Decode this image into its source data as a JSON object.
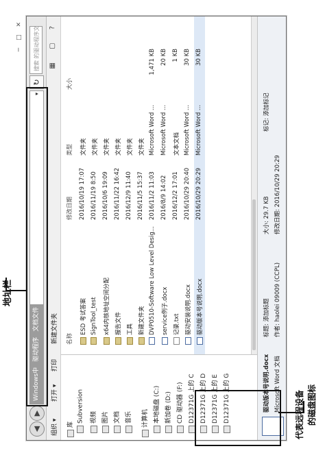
{
  "window": {
    "address": [
      "Windows中",
      "驱动程序",
      "文档文件"
    ],
    "address_dropdown": "▾",
    "refresh_icon": "↻",
    "search_placeholder": "搜索 的驱动程序文件",
    "window_controls": "─ □ ✕",
    "back_icon": "◀",
    "forward_icon": "▶"
  },
  "toolbar": {
    "organize": "组织 ▾",
    "open": "打开 ▾",
    "print": "打印",
    "new_folder": "新建文件夹",
    "view_icons": "▦ ▢ ?"
  },
  "sidebar": {
    "items": [
      {
        "icon": "library-icon",
        "label": "库"
      },
      {
        "icon": "subversion-icon",
        "label": "Subversion"
      },
      {
        "icon": "video-icon",
        "label": "视频"
      },
      {
        "icon": "picture-icon",
        "label": "图片"
      },
      {
        "icon": "document-icon",
        "label": "文档"
      },
      {
        "icon": "music-icon",
        "label": "音乐"
      },
      {
        "icon": "computer-icon",
        "label": "计算机"
      },
      {
        "icon": "drive-icon",
        "label": "本地磁盘 (C:)"
      },
      {
        "icon": "drive-icon",
        "label": "新加卷 (D:)"
      },
      {
        "icon": "cd-icon",
        "label": "CD 驱动器 (F:)"
      },
      {
        "icon": "network-drive-icon",
        "label": "D12371G 上的 C"
      },
      {
        "icon": "network-drive-icon",
        "label": "D12371G 上的 D"
      },
      {
        "icon": "network-drive-icon",
        "label": "D12371G 上的 E"
      },
      {
        "icon": "network-drive-icon",
        "label": "D12371G 上的 G"
      }
    ]
  },
  "columns": {
    "name": "名称",
    "modified": "修改日期",
    "type": "类型",
    "size": "大小"
  },
  "files": [
    {
      "icon": "folder-icon",
      "name": "ESD 考试答案",
      "modified": "2016/10/19 17:07",
      "type": "文件夹",
      "size": ""
    },
    {
      "icon": "folder-icon",
      "name": "SignTool_test",
      "modified": "2016/11/19 8:50",
      "type": "文件夹",
      "size": ""
    },
    {
      "icon": "folder-icon",
      "name": "x64内核地址空间分配",
      "modified": "2016/10/6 19:09",
      "type": "文件夹",
      "size": ""
    },
    {
      "icon": "folder-icon",
      "name": "报告文件",
      "modified": "2016/11/22 16:42",
      "type": "文件夹",
      "size": ""
    },
    {
      "icon": "folder-icon",
      "name": "工具",
      "modified": "2016/12/9 11:40",
      "type": "文件夹",
      "size": ""
    },
    {
      "icon": "folder-icon",
      "name": "新建文件夹",
      "modified": "2016/11/5 15:37",
      "type": "文件夹",
      "size": ""
    },
    {
      "icon": "doc-icon",
      "name": "DVP0510-Software Low Level Desig...",
      "modified": "2016/11/2 11:03",
      "type": "Microsoft Word ...",
      "size": "1,471 KB"
    },
    {
      "icon": "doc-icon",
      "name": "service例子.docx",
      "modified": "2016/8/9 14:02",
      "type": "Microsoft Word ...",
      "size": "20 KB"
    },
    {
      "icon": "txt-icon",
      "name": "记录.txt",
      "modified": "2016/12/2 17:01",
      "type": "文本文档",
      "size": "1 KB"
    },
    {
      "icon": "doc-icon",
      "name": "驱动安装说明.docx",
      "modified": "2016/10/29 20:40",
      "type": "Microsoft Word ...",
      "size": "30 KB"
    },
    {
      "icon": "doc-icon",
      "name": "驱动版本号说明.docx",
      "modified": "2016/10/29 20:29",
      "type": "Microsoft Word ...",
      "size": "30 KB"
    }
  ],
  "details": {
    "filename": "驱动版本号说明.docx",
    "title_label": "标题: 添加标题",
    "doc_type": "Microsoft Word 文档",
    "author": "作者: haolei 09009 (CCPL)",
    "size": "大小: 29.7 KB",
    "modified": "修改日期: 2016/10/29 20:29",
    "tags": "标记: 添加标记"
  },
  "annotations": {
    "address_bar": "地址栏",
    "remote_drives_line1": "代表远程设备",
    "remote_drives_line2": "的磁盘图标"
  }
}
